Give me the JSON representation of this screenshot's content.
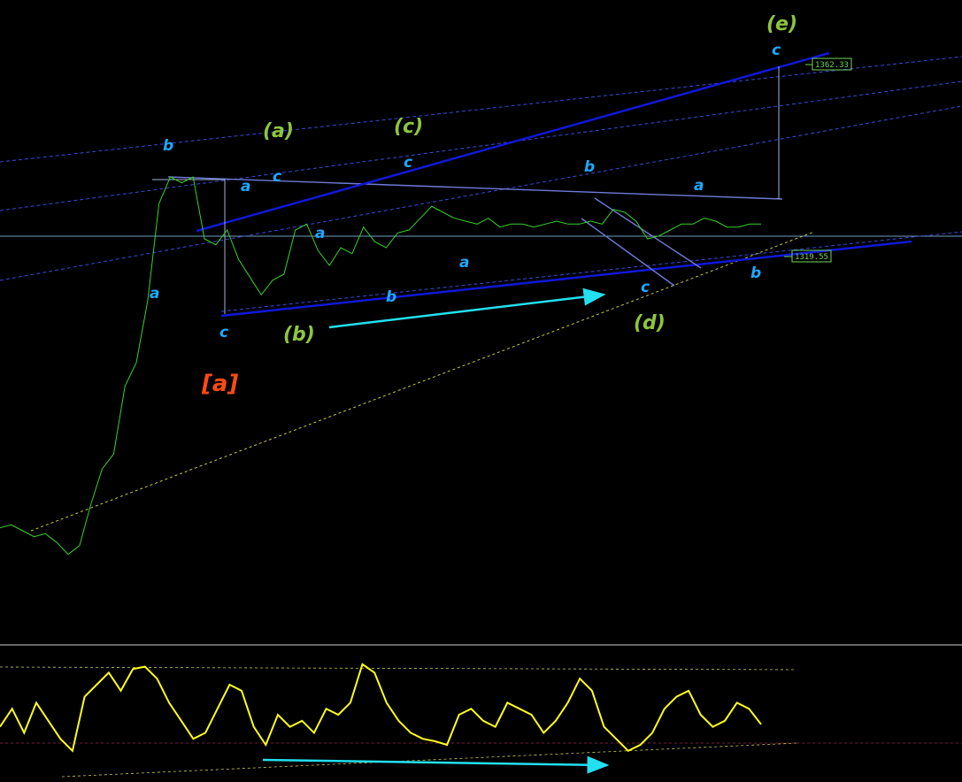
{
  "colors": {
    "background": "#000000",
    "price_line": "#38d12a",
    "oscillator_line": "#ffff1a",
    "channel_blue": "#1018d8",
    "triangle_line": "#6f7bd6",
    "dashed_channel": "#3a48d8",
    "dashed_support": "#c8c84a",
    "arrow_cyan": "#22e0f0",
    "label_blue": "#1fa8ff",
    "label_green": "#8dc63f",
    "label_red": "#ff4a12",
    "price_tag": "#6fd35a"
  },
  "price_tags": {
    "upper": "1362.33",
    "lower": "1319.55"
  },
  "wave_labels": {
    "degree_primary": "[a]",
    "degree_intermediate": [
      "(a)",
      "(b)",
      "(c)",
      "(d)",
      "(e)"
    ],
    "minor": [
      "a",
      "b",
      "c"
    ]
  },
  "chart_data": {
    "type": "line",
    "panels": [
      "price",
      "oscillator"
    ],
    "series": [
      {
        "values": [
          1228,
          1229,
          1227,
          1225,
          1226,
          1223,
          1219,
          1222,
          1236,
          1248,
          1253,
          1276,
          1284,
          1305,
          1338,
          1347,
          1345,
          1347,
          1326,
          1324,
          1329,
          1319,
          1313,
          1307,
          1312,
          1314,
          1329,
          1331,
          1322,
          1317,
          1323,
          1321,
          1330,
          1325,
          1323,
          1328,
          1329,
          1333,
          1337,
          1335,
          1333,
          1332,
          1331,
          1333,
          1330,
          1331,
          1331,
          1330,
          1331,
          1332,
          1331,
          1331,
          1332,
          1331,
          1336,
          1335,
          1332,
          1326,
          1327,
          1329,
          1331,
          1331,
          1333,
          1332,
          1330,
          1330,
          1331,
          1331
        ]
      },
      {
        "values": [
          40,
          55,
          35,
          60,
          45,
          30,
          20,
          65,
          75,
          85,
          70,
          88,
          90,
          80,
          60,
          45,
          30,
          35,
          55,
          75,
          70,
          40,
          25,
          50,
          40,
          45,
          35,
          55,
          50,
          60,
          92,
          85,
          60,
          45,
          35,
          30,
          28,
          25,
          50,
          55,
          45,
          40,
          60,
          55,
          50,
          35,
          45,
          60,
          80,
          70,
          40,
          30,
          20,
          25,
          35,
          55,
          65,
          70,
          50,
          40,
          45,
          60,
          55,
          42
        ]
      }
    ]
  }
}
